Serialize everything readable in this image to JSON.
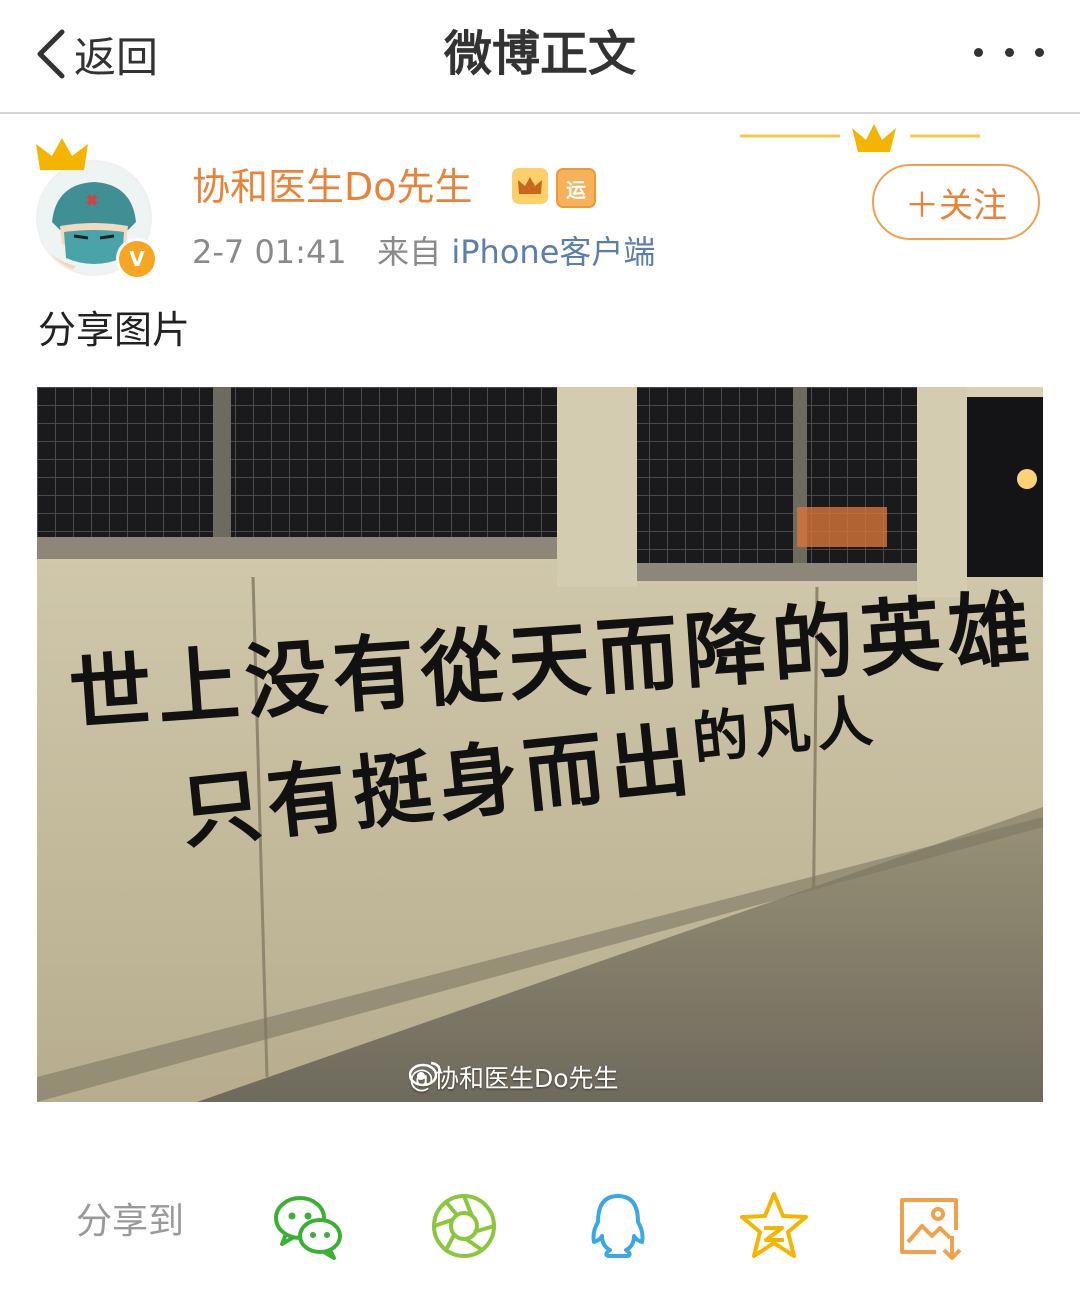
{
  "header": {
    "back_label": "返回",
    "title": "微博正文",
    "more_icon": "more-dots-icon"
  },
  "post": {
    "username": "协和医生Do先生",
    "badges": [
      {
        "name": "vip-crown-badge",
        "color": "#ffcf6b"
      },
      {
        "name": "yun-badge",
        "text": "运",
        "color": "#f6b15a"
      }
    ],
    "verify_mark": "V",
    "time": "2-7 01:41",
    "source_prefix": "来自",
    "source": "iPhone客户端",
    "follow_label": "＋关注",
    "text": "分享图片"
  },
  "photo": {
    "graffiti_line1": "世上没有從天而降的英雄",
    "graffiti_line2_a": "只有挺身而出",
    "graffiti_line2_b": "的凡人",
    "watermark": "@协和医生Do先生"
  },
  "share": {
    "label": "分享到",
    "icons": [
      "wechat-icon",
      "moments-icon",
      "qq-icon",
      "qzone-icon",
      "save-image-icon"
    ]
  },
  "colors": {
    "accent": "#e8833a",
    "link": "#5b7fa6",
    "wechat": "#3cb035",
    "moments": "#8cc63f",
    "qq": "#3aa7e6",
    "qzone": "#f5b400",
    "save": "#f0a14c"
  }
}
